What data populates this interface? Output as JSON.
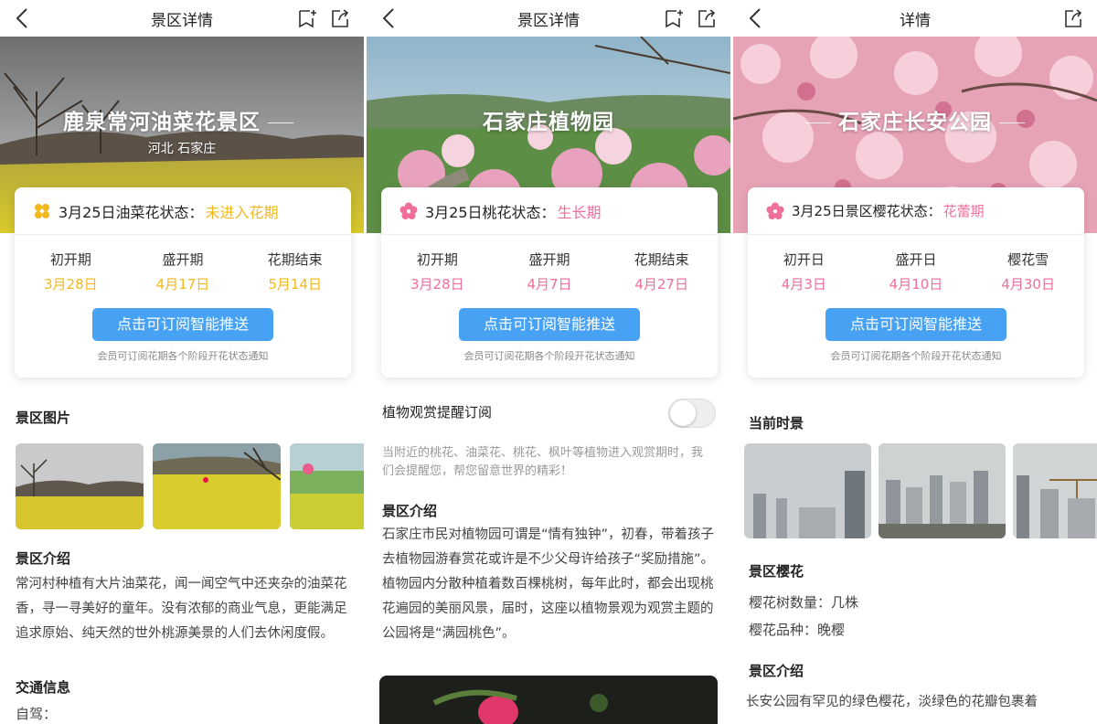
{
  "colors": {
    "accent_blue": "#47a2f3",
    "yellow": "#f2b81d",
    "pink": "#ef6f99"
  },
  "panels": [
    {
      "nav": {
        "title": "景区详情"
      },
      "hero": {
        "title": "鹿泉常河油菜花景区",
        "subtitle": "河北 石家庄"
      },
      "status": {
        "date_prefix": "3月25日油菜花状态：",
        "state": "未进入花期",
        "stages": [
          {
            "label": "初开期",
            "date": "3月28日"
          },
          {
            "label": "盛开期",
            "date": "4月17日"
          },
          {
            "label": "花期结束",
            "date": "5月14日"
          }
        ],
        "button": "点击可订阅智能推送",
        "note": "会员可订阅花期各个阶段开花状态通知"
      },
      "photos_title": "景区图片",
      "intro_title": "景区介绍",
      "intro_text": "常河村种植有大片油菜花，闻一闻空气中还夹杂的油菜花香，寻一寻美好的童年。没有浓郁的商业气息，更能满足追求原始、纯天然的世外桃源美景的人们去休闲度假。",
      "traffic_title": "交通信息",
      "traffic_text": "自驾："
    },
    {
      "nav": {
        "title": "景区详情"
      },
      "hero": {
        "title": "石家庄植物园"
      },
      "status": {
        "date_prefix": "3月25日桃花状态：",
        "state": "生长期",
        "stages": [
          {
            "label": "初开期",
            "date": "3月28日"
          },
          {
            "label": "盛开期",
            "date": "4月7日"
          },
          {
            "label": "花期结束",
            "date": "4月27日"
          }
        ],
        "button": "点击可订阅智能推送",
        "note": "会员可订阅花期各个阶段开花状态通知"
      },
      "reminder_label": "植物观赏提醒订阅",
      "reminder_desc": "当附近的桃花、油菜花、桃花、枫叶等植物进入观赏期时，我们会提醒您，帮您留意世界的精彩！",
      "intro_title": "景区介绍",
      "intro_text": "石家庄市民对植物园可谓是“情有独钟”，初春，带着孩子去植物园游春赏花或许是不少父母许给孩子“奖励措施”。植物园内分散种植着数百棵桃树，每年此时，都会出现桃花遍园的美丽风景，届时，这座以植物景观为观赏主题的公园将是“满园桃色”。"
    },
    {
      "nav": {
        "title": "详情"
      },
      "hero": {
        "title": "石家庄长安公园"
      },
      "status": {
        "date_prefix": "3月25日景区樱花状态：",
        "state": "花蕾期",
        "stages": [
          {
            "label": "初开日",
            "date": "4月3日"
          },
          {
            "label": "盛开日",
            "date": "4月10日"
          },
          {
            "label": "樱花雪",
            "date": "4月30日"
          }
        ],
        "button": "点击可订阅智能推送",
        "note": "会员可订阅花期各个阶段开花状态通知"
      },
      "scene_title": "当前时景",
      "sakura_title": "景区樱花",
      "sakura_count": "樱花树数量：几株",
      "sakura_variety": "樱花品种：晚樱",
      "intro_title": "景区介绍",
      "intro_text": "长安公园有罕见的绿色樱花，淡绿色的花瓣包裹着"
    }
  ]
}
